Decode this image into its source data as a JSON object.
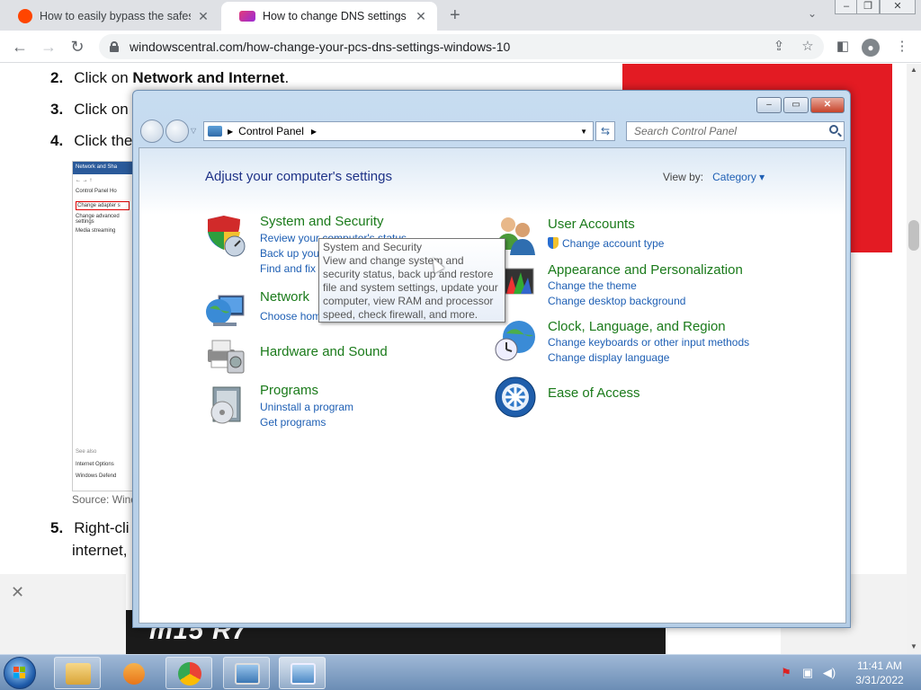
{
  "browser": {
    "tabs": [
      {
        "title": "How to easily bypass the safesearch",
        "active": false,
        "favicon": "reddit-icon",
        "color": "#ff4500"
      },
      {
        "title": "How to change DNS settings on",
        "active": true,
        "favicon": "windowscentral-icon",
        "color": "#9b2bd6"
      }
    ],
    "new_tab": "+",
    "url": "windowscentral.com/how-change-your-pcs-dns-settings-windows-10"
  },
  "article": {
    "steps": [
      {
        "num": "2.",
        "prefix": "Click on ",
        "bold": "Network and Internet",
        "suffix": "."
      },
      {
        "num": "3.",
        "prefix": "Click on",
        "bold": "",
        "suffix": ""
      },
      {
        "num": "4.",
        "prefix": "Click the",
        "bold": "",
        "suffix": ""
      },
      {
        "num": "5.",
        "prefix": "Right-cli",
        "bold": "",
        "suffix": ""
      }
    ],
    "step5_line2": "internet,",
    "source": "Source: Wind",
    "thumb": {
      "title": "Network and Sha",
      "crumb": "Control Panel Ho",
      "links": [
        "Change adapter s",
        "Change advanced settings",
        "Media streaming"
      ],
      "footer": [
        "See also",
        "Internet Options",
        "Windows Defend"
      ]
    },
    "ad_text": "m15 R7"
  },
  "control_panel": {
    "breadcrumb": "Control Panel",
    "search_placeholder": "Search Control Panel",
    "heading": "Adjust your computer's settings",
    "view_by_label": "View by:",
    "view_by_value": "Category",
    "categories_left": [
      {
        "title": "System and Security",
        "links": [
          "Review your computer's status",
          "Back up your",
          "Find and fix"
        ]
      },
      {
        "title": "Network",
        "links": [
          "Choose hom"
        ]
      },
      {
        "title": "Hardware and Sound",
        "links": []
      },
      {
        "title": "Programs",
        "links": [
          "Uninstall a program",
          "Get programs"
        ]
      }
    ],
    "categories_right": [
      {
        "title": "User Accounts",
        "links": [
          "Change account type"
        ]
      },
      {
        "title": "Appearance and Personalization",
        "links": [
          "Change the theme",
          "Change desktop background"
        ]
      },
      {
        "title": "Clock, Language, and Region",
        "links": [
          "Change keyboards or other input methods",
          "Change display language"
        ]
      },
      {
        "title": "Ease of Access",
        "links": []
      }
    ],
    "tooltip": {
      "title": "System and Security",
      "body": "View and change system and security status, back up and restore file and system settings, update your computer, view RAM and processor speed, check firewall, and more."
    }
  },
  "taskbar": {
    "time": "11:41 AM",
    "date": "3/31/2022"
  }
}
